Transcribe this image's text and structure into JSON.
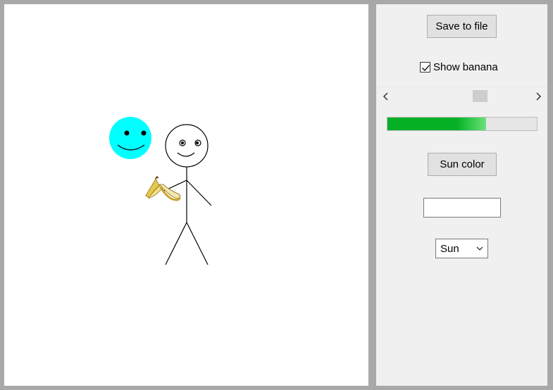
{
  "canvas": {
    "sun": {
      "color": "#00ffff",
      "name": "sun"
    },
    "stick_figure": {
      "stroke": "#000000"
    },
    "banana": {
      "visible": true,
      "name": "banana"
    }
  },
  "panel": {
    "save_button": {
      "label": "Save to file"
    },
    "show_banana": {
      "label": "Show banana",
      "checked": true
    },
    "scrollbar": {
      "value_fraction": 0.65
    },
    "progress": {
      "value_fraction": 0.66,
      "color": "#06b025"
    },
    "sun_color_button": {
      "label": "Sun color"
    },
    "text_input": {
      "value": ""
    },
    "dropdown": {
      "selected": "Sun"
    }
  }
}
